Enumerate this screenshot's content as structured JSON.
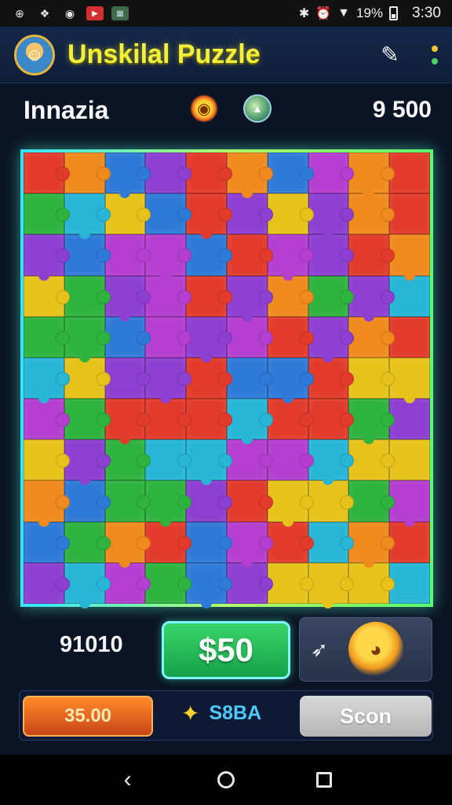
{
  "status_bar": {
    "left_icons": [
      "download-icon",
      "photos-icon",
      "chat-icon",
      "youtube-icon",
      "image-icon"
    ],
    "right_icons": [
      "bluetooth-icon",
      "alarm-icon",
      "wifi-icon"
    ],
    "battery_percent": "19%",
    "time": "3:30"
  },
  "header": {
    "title": "Unskilal Puzzle",
    "avatar_icon": "player-avatar",
    "edit_icon": "pencil-icon",
    "menu_dot_colors": [
      "#f1c232",
      "#4bd26a"
    ]
  },
  "info": {
    "player_name": "Innazia",
    "score": "9 500",
    "badge_icons": [
      "fish-emblem-icon",
      "globe-icon"
    ]
  },
  "board": {
    "rows": 11,
    "cols": 10,
    "palette": [
      "#2f7ad8",
      "#8d3fd1",
      "#2fb33f",
      "#e23b2c",
      "#f08a1e",
      "#e6c21a",
      "#27b6d6",
      "#b43ed0"
    ],
    "border_colors": [
      "#33e4ff",
      "#b3ff6a",
      "#5cff6d"
    ]
  },
  "controls": {
    "count": "91010",
    "buy_label": "$50",
    "mascot_icon": "orange-mascot-icon",
    "rocket_icon": "rocket-icon",
    "left_button": "35.00",
    "middle_icon": "sparkle-icon",
    "middle_value": "S8BA",
    "right_button": "Scon"
  },
  "nav": {
    "icons": [
      "back-icon",
      "home-icon",
      "recents-icon"
    ]
  }
}
